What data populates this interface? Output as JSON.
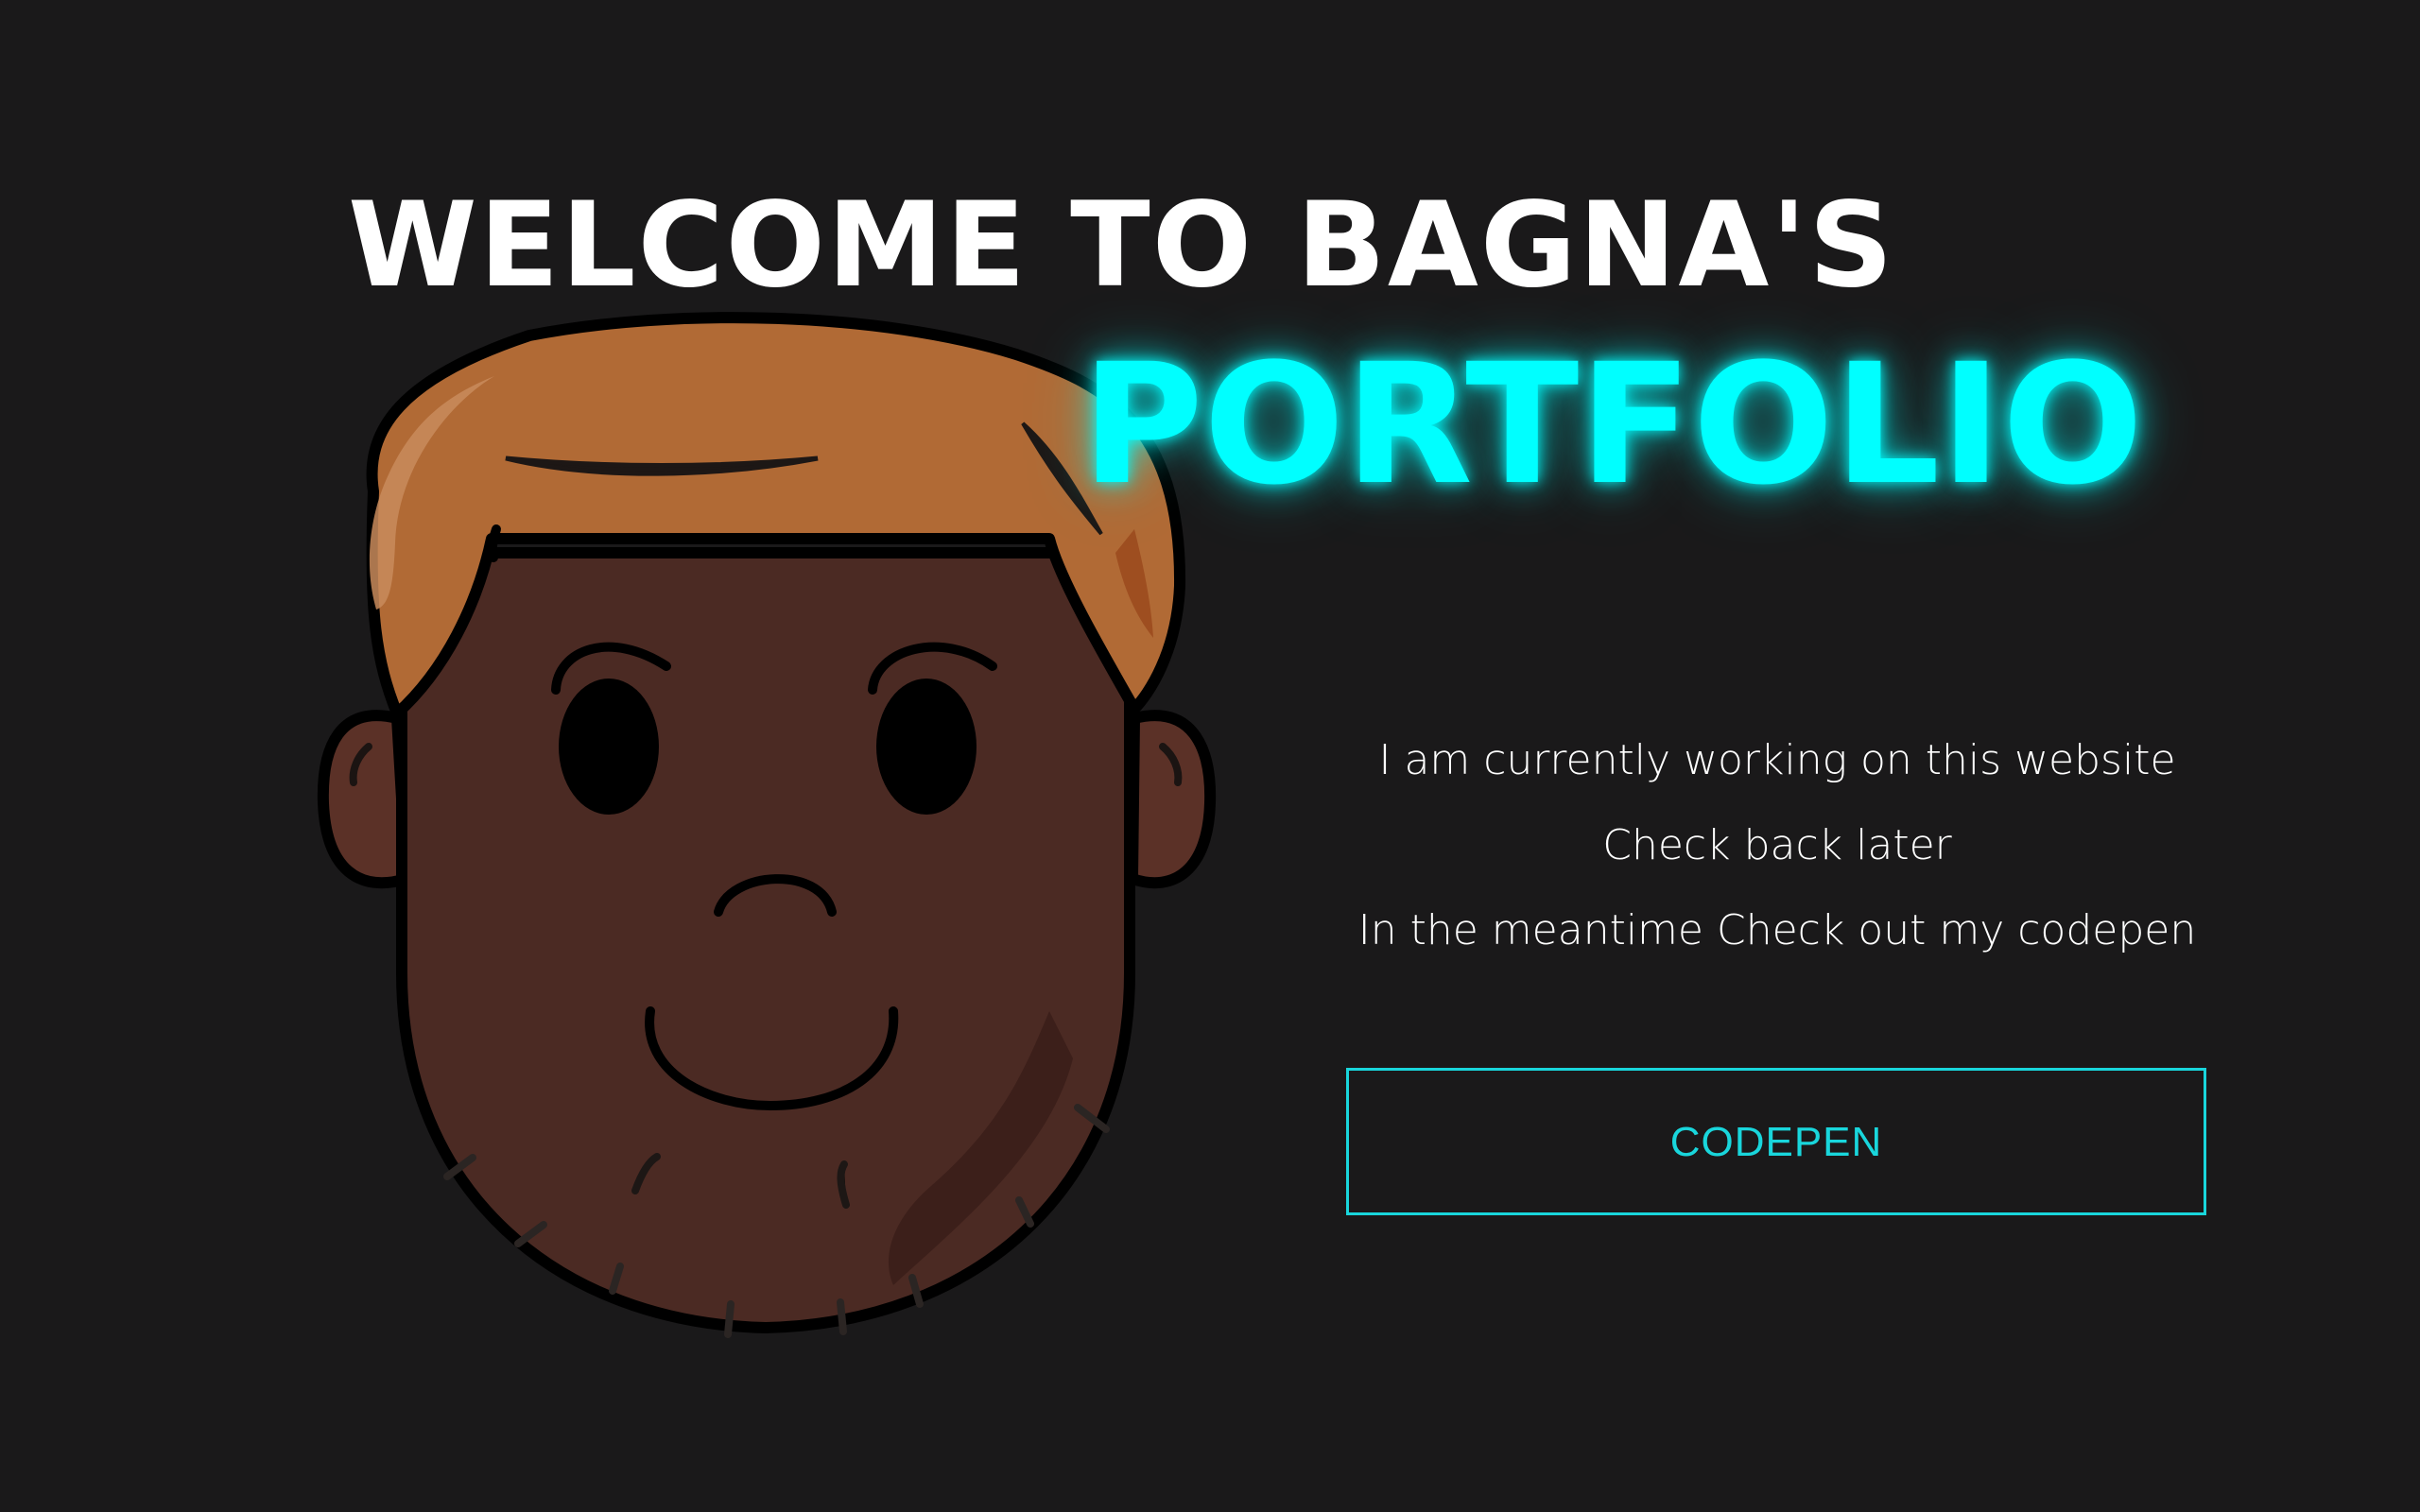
{
  "hero": {
    "welcome": "WELCOME TO BAGNA'S",
    "portfolio": "PORTFOLIO"
  },
  "message": {
    "lines": [
      "I am currently working on this website",
      "Check back later",
      "In the meantime Check out my codepen"
    ]
  },
  "actions": {
    "codepen_label": "CODEPEN"
  },
  "avatar": {
    "icon": "cartoon-face-icon"
  },
  "colors": {
    "background": "#1a191a",
    "accent": "#00ffff",
    "button": "#19d6dc",
    "skin": "#4b2a23",
    "hair": "#b16a35"
  }
}
